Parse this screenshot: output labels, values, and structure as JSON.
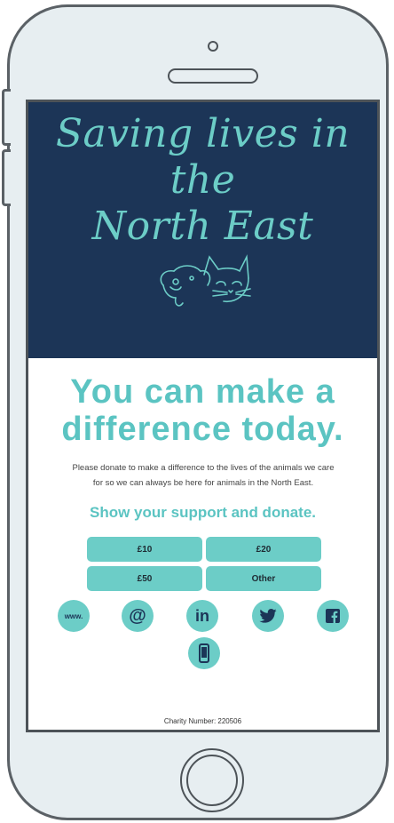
{
  "hero": {
    "title_line1": "Saving lives in the",
    "title_line2": "North East"
  },
  "main": {
    "headline_line1": "You can make a",
    "headline_line2": "difference today.",
    "paragraph_line1": "Please donate to make a difference to the lives of the animals we care",
    "paragraph_line2": "for so we can always be here for animals in the North East.",
    "support_heading": "Show your support and donate."
  },
  "donate_buttons": [
    "£10",
    "£20",
    "£50",
    "Other"
  ],
  "social_icons": [
    {
      "name": "website-icon",
      "label": "www."
    },
    {
      "name": "email-icon",
      "label": "@"
    },
    {
      "name": "linkedin-icon",
      "label": "in"
    },
    {
      "name": "twitter-icon",
      "label": ""
    },
    {
      "name": "facebook-icon",
      "label": ""
    },
    {
      "name": "phone-icon",
      "label": ""
    }
  ],
  "footer": {
    "charity_number": "Charity Number: 220506"
  },
  "colors": {
    "navy": "#1c3557",
    "teal": "#6ccdc7",
    "teal_text": "#5bc4c2"
  }
}
